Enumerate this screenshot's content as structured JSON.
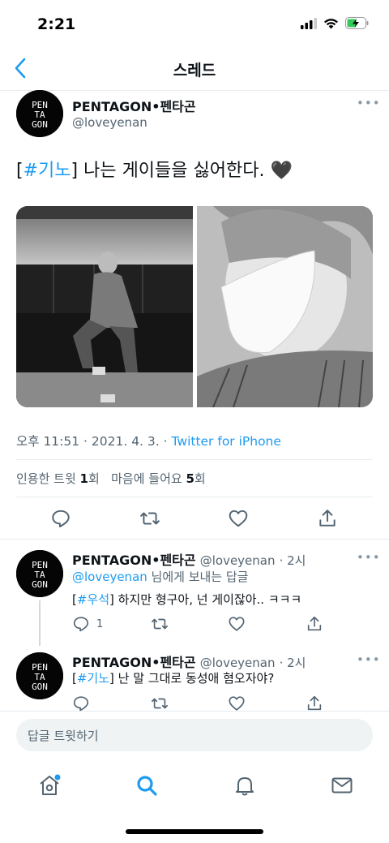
{
  "status": {
    "time": "2:21"
  },
  "nav": {
    "title": "스레드"
  },
  "tweet": {
    "name": "PENTAGON•펜타곤",
    "handle": "@loveyenan",
    "hashtag": "#기노",
    "text_before": "[",
    "text_after": "] 나는 게이들을 싫어한다. 🖤",
    "time": "오후 11:51 · 2021. 4. 3. · ",
    "source": "Twitter for iPhone",
    "quote_label": "인용한 트윗 ",
    "quote_count": "1",
    "quote_unit": "회",
    "like_label": "마음에 들어요 ",
    "like_count": "5",
    "like_unit": "회"
  },
  "avatar_text": {
    "l1": "PEN",
    "l2": "TA",
    "l3": "GON"
  },
  "replies": [
    {
      "name": "PENTAGON•펜타곤",
      "handle": "@loveyenan",
      "age": "· 2시",
      "reply_to": "@loveyenan",
      "reply_to_suffix": " 님에게 보내는 답글",
      "hashtag": "#우석",
      "text_after": "] 하지만 형구아, 넌 게이잖아.. ㅋㅋㅋ",
      "reply_count": "1"
    },
    {
      "name": "PENTAGON•펜타곤",
      "handle": "@loveyenan",
      "age": "· 2시",
      "hashtag": "#기노",
      "text_after": "] 난 말 그대로 동성애 혐오자야?"
    }
  ],
  "compose": {
    "placeholder": "답글 트윗하기"
  },
  "colors": {
    "accent": "#1d9bf0",
    "text": "#0f1419",
    "muted": "#536471"
  },
  "icons": [
    "back-chevron-icon",
    "more-icon",
    "reply-icon",
    "retweet-icon",
    "like-icon",
    "share-icon",
    "home-icon",
    "search-icon",
    "notifications-icon",
    "messages-icon"
  ]
}
